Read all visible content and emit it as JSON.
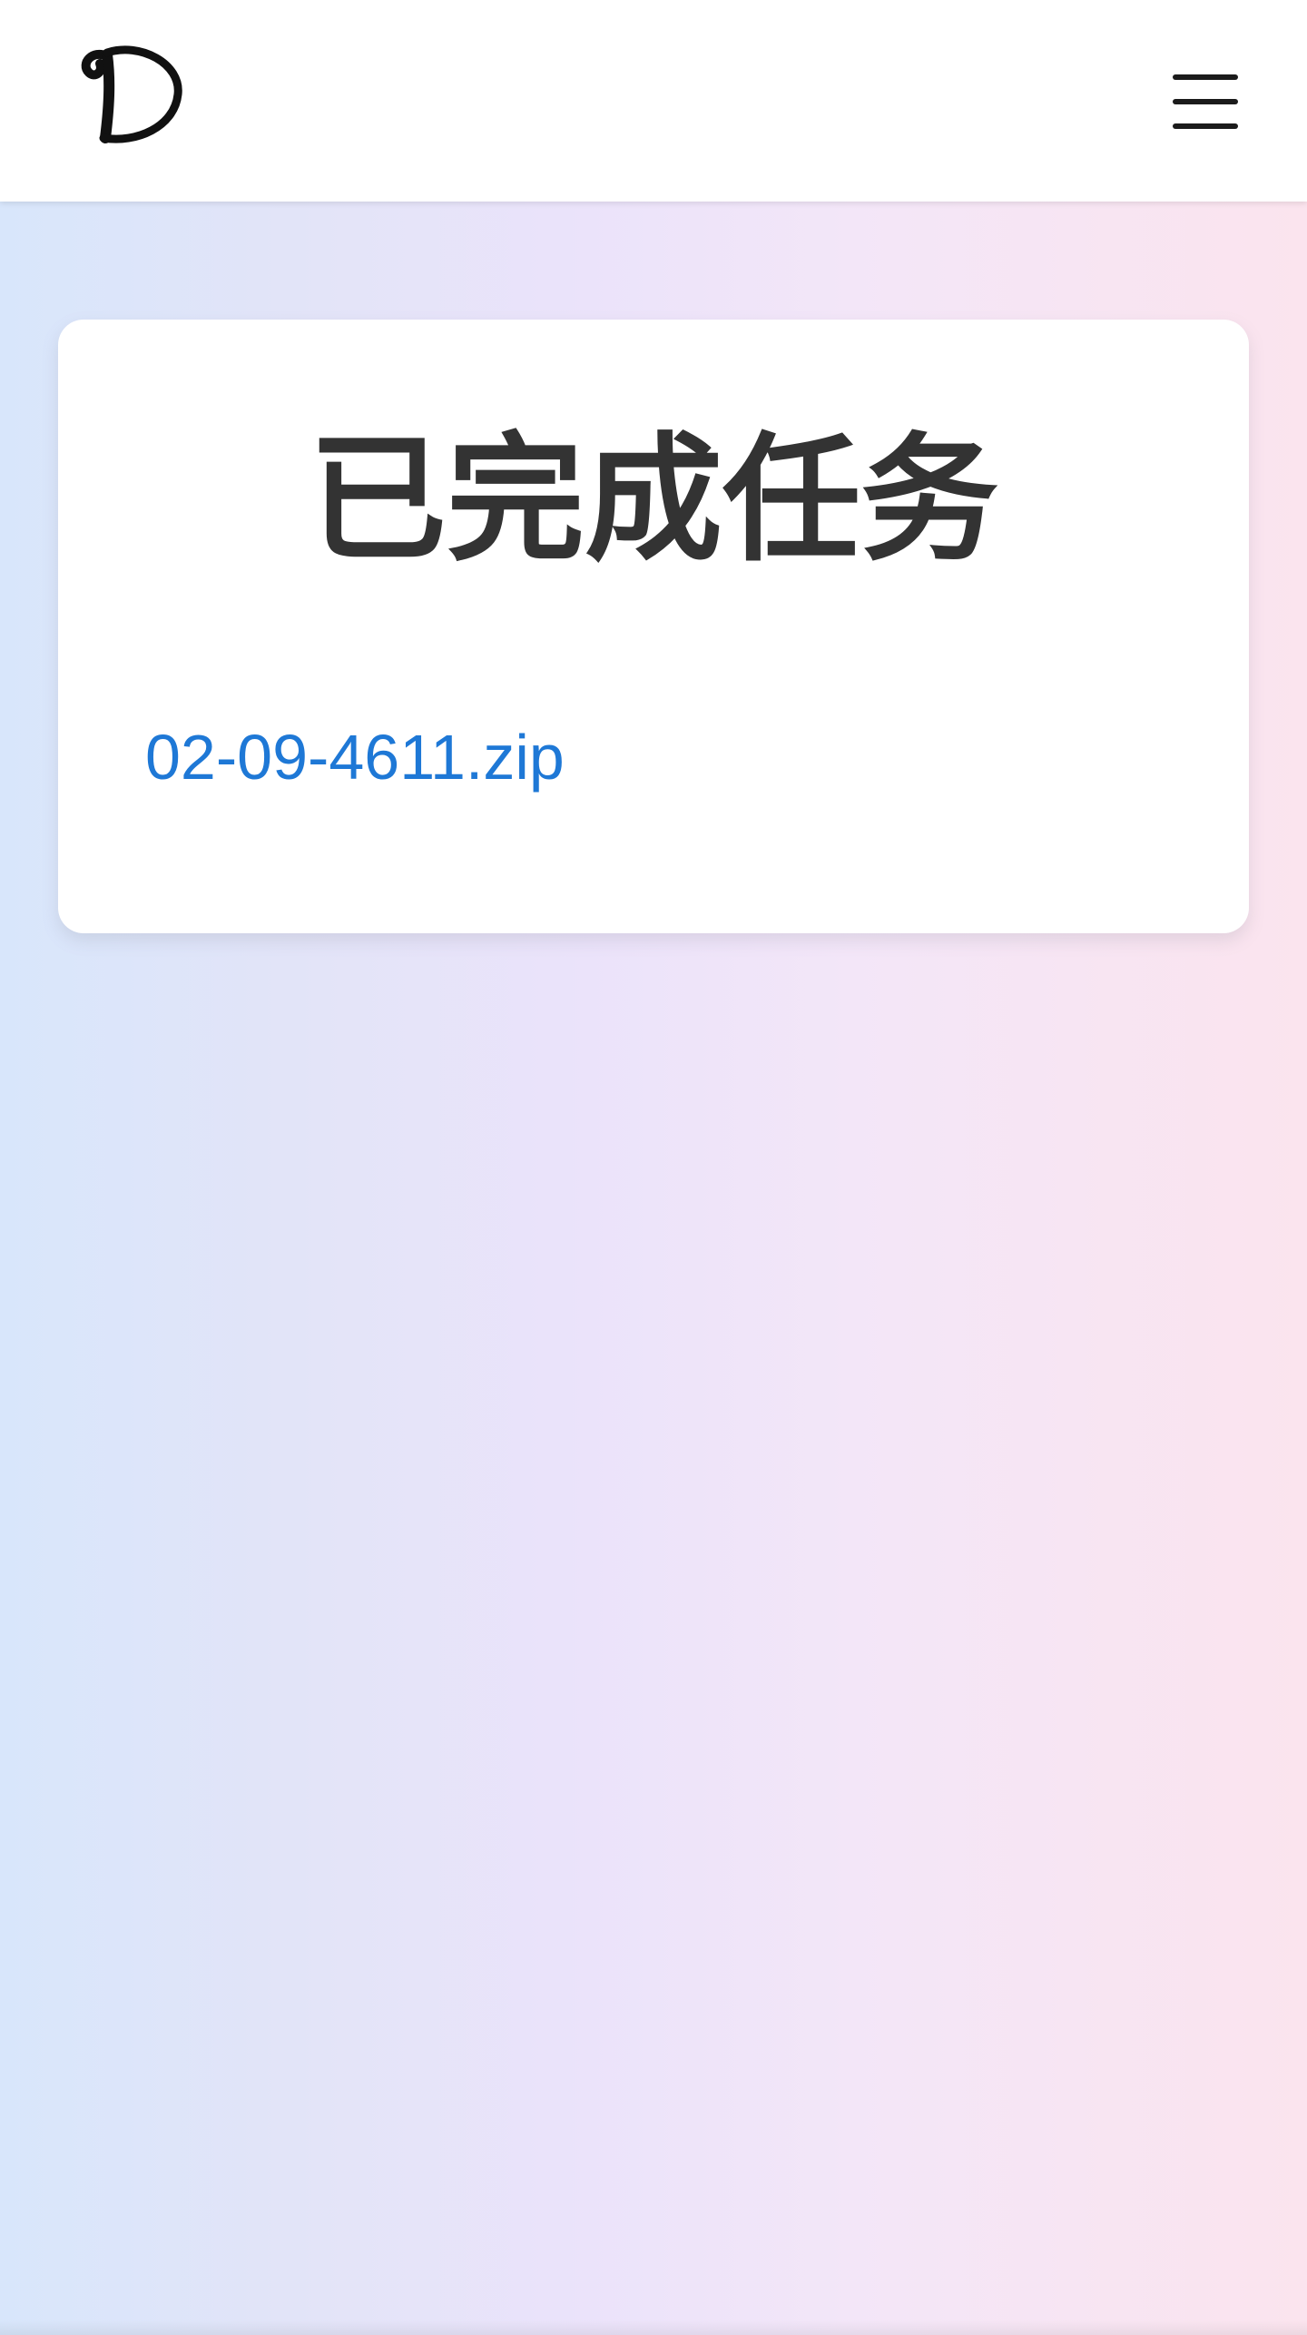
{
  "header": {
    "logo_icon": "handwritten-d-logo-icon",
    "menu_icon": "hamburger-menu-icon"
  },
  "main": {
    "title": "已完成任务",
    "files": [
      {
        "name": "02-09-4611.zip"
      }
    ]
  },
  "colors": {
    "title_text": "#333333",
    "link": "#1e78d6",
    "icon": "#1b1b1b",
    "card_background": "#ffffff",
    "page_gradient_start": "#d8e6fb",
    "page_gradient_end": "#fbe4ee"
  }
}
